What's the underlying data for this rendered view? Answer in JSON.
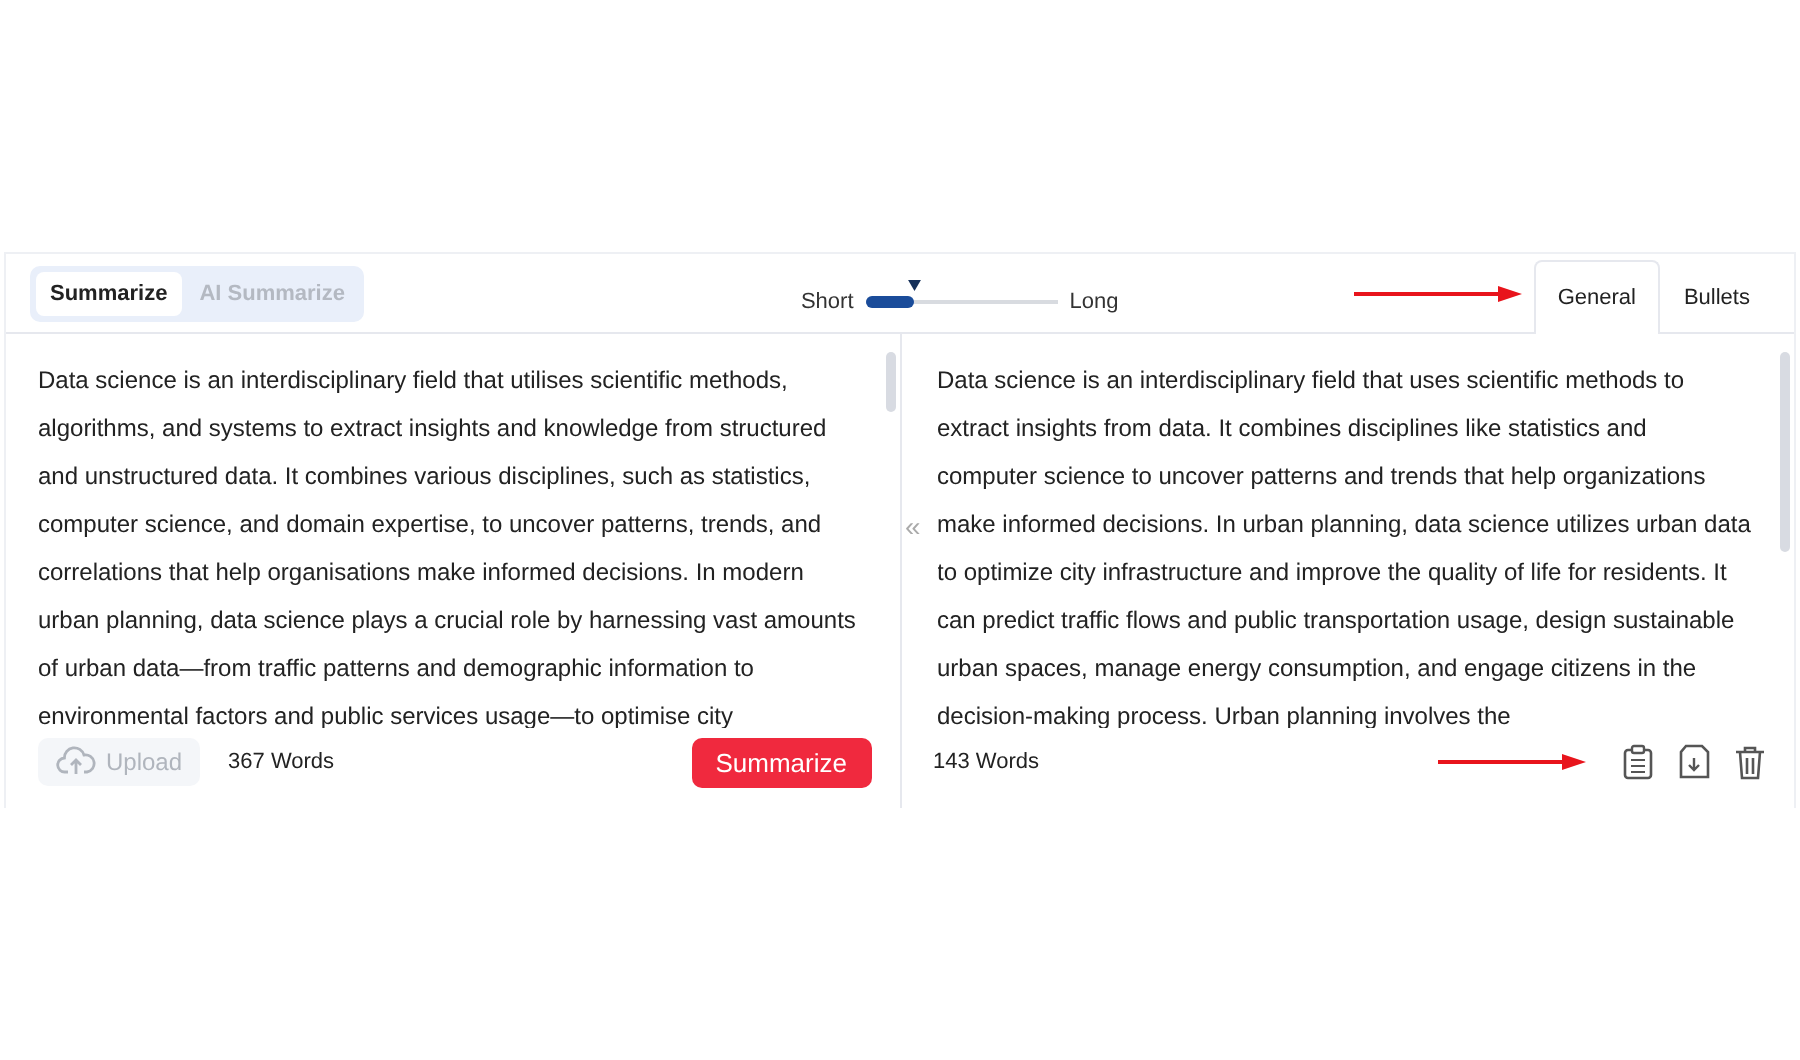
{
  "mode_tabs": [
    {
      "label": "Summarize",
      "selected": true
    },
    {
      "label": "AI Summarize",
      "selected": false
    }
  ],
  "length_slider": {
    "min_label": "Short",
    "max_label": "Long",
    "level": 0.25
  },
  "output_tabs": [
    {
      "label": "General",
      "selected": true
    },
    {
      "label": "Bullets",
      "selected": false
    }
  ],
  "input": {
    "text": "Data science is an interdisciplinary field that utilises scientific methods, algorithms, and systems to extract insights and knowledge from structured and unstructured data. It combines various disciplines, such as statistics, computer science, and domain expertise, to uncover patterns, trends, and correlations that help organisations make informed decisions. In modern urban planning, data science plays a crucial role by harnessing vast amounts of urban data—from traffic patterns and demographic information to environmental factors and public services usage—to optimise city",
    "upload_label": "Upload",
    "upload_disabled": true,
    "word_count": "367 Words",
    "submit_label": "Summarize"
  },
  "collapse_toggle": "«",
  "output": {
    "text": "Data science is an interdisciplinary field that uses scientific methods to extract insights from data. It combines disciplines like statistics and computer science to uncover patterns and trends that help organizations make informed decisions. In urban planning, data science utilizes urban data to optimize city infrastructure and improve the quality of life for residents. It can predict traffic flows and public transportation usage, design sustainable urban spaces, manage energy consumption, and engage citizens in the decision-making process. Urban planning involves the",
    "word_count": "143 Words"
  }
}
